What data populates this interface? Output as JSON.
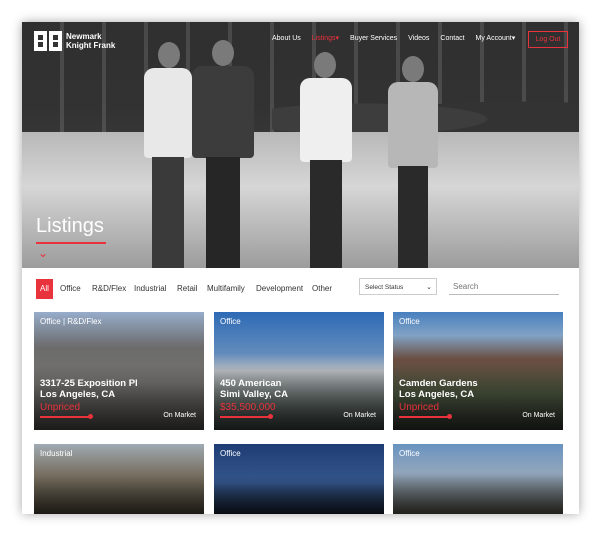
{
  "brand": {
    "name_line1": "Newmark",
    "name_line2": "Knight Frank"
  },
  "nav": {
    "items": [
      {
        "label": "About Us",
        "active": false
      },
      {
        "label": "Listings",
        "active": true,
        "caret": "▾"
      },
      {
        "label": "Buyer Services",
        "active": false
      },
      {
        "label": "Videos",
        "active": false
      },
      {
        "label": "Contact",
        "active": false
      },
      {
        "label": "My Account",
        "active": false,
        "caret": "▾"
      }
    ],
    "logout": "Log Out"
  },
  "hero": {
    "title": "Listings"
  },
  "filters": {
    "tabs": [
      "All",
      "Office",
      "R&D/Flex",
      "Industrial",
      "Retail",
      "Multifamily",
      "Development",
      "Other"
    ],
    "active_tab": "All",
    "status_select": "Select Status",
    "search_placeholder": "Search"
  },
  "listings": [
    {
      "category": "Office | R&D/Flex",
      "address_line1": "3317-25 Exposition Pl",
      "address_line2": "Los Angeles, CA",
      "price": "Unpriced",
      "status": "On Market"
    },
    {
      "category": "Office",
      "address_line1": "450 American",
      "address_line2": "Simi Valley, CA",
      "price": "$35,500,000",
      "status": "On Market"
    },
    {
      "category": "Office",
      "address_line1": "Camden Gardens",
      "address_line2": "Los Angeles, CA",
      "price": "Unpriced",
      "status": "On Market"
    },
    {
      "category": "Industrial"
    },
    {
      "category": "Office"
    },
    {
      "category": "Office"
    }
  ],
  "colors": {
    "accent": "#e8323c",
    "text_dark": "#333333"
  }
}
